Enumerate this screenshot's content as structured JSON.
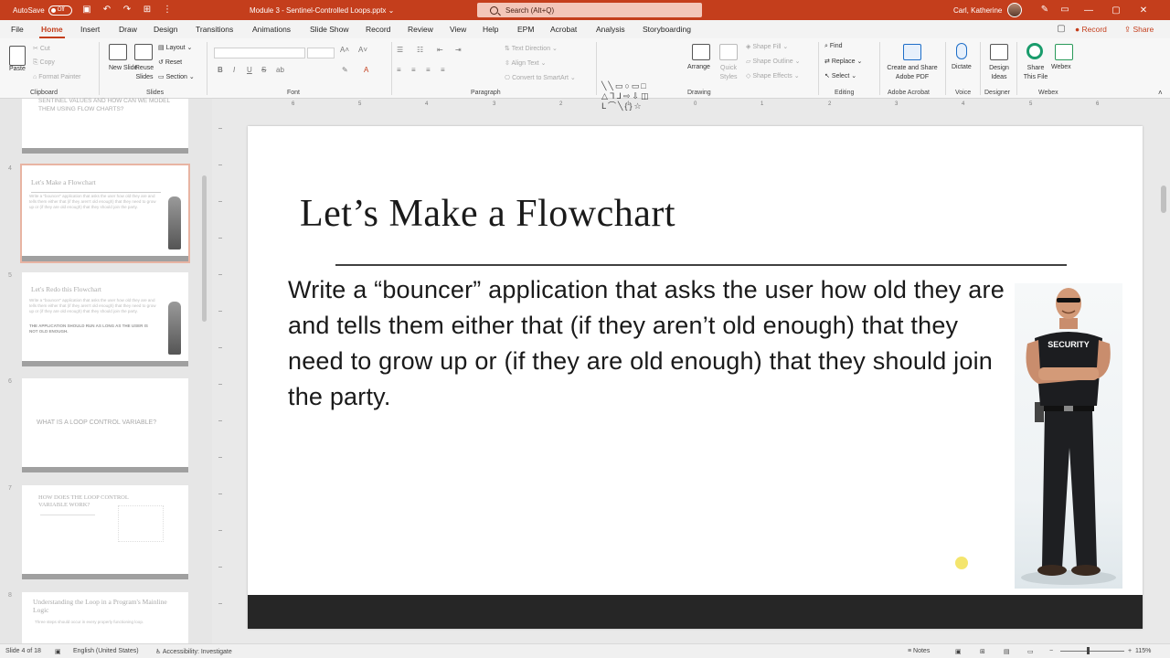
{
  "titlebar": {
    "autosave_label": "AutoSave",
    "autosave_state": "Off",
    "document_title": "Module 3 - Sentinel-Controlled Loops.pptx",
    "search_placeholder": "Search (Alt+Q)",
    "user_name": "Carl, Katherine",
    "minimize": "—",
    "maximize": "▢",
    "close": "✕"
  },
  "menu": {
    "tabs": [
      "File",
      "Home",
      "Insert",
      "Draw",
      "Design",
      "Transitions",
      "Animations",
      "Slide Show",
      "Record",
      "Review",
      "View",
      "Help",
      "EPM",
      "Acrobat",
      "Analysis",
      "Storyboarding"
    ],
    "active": "Home",
    "record": "Record",
    "share": "Share"
  },
  "ribbon": {
    "clipboard": {
      "label": "Clipboard",
      "paste": "Paste",
      "cut": "Cut",
      "copy": "Copy",
      "format_painter": "Format Painter"
    },
    "slides": {
      "label": "Slides",
      "new_slide": "New Slide",
      "reuse_slides": "Reuse Slides",
      "layout": "Layout",
      "reset": "Reset",
      "section": "Section"
    },
    "font": {
      "label": "Font",
      "bold": "B",
      "italic": "I",
      "underline": "U",
      "strike": "S",
      "shadow": "ab"
    },
    "paragraph": {
      "label": "Paragraph",
      "text_direction": "Text Direction",
      "align_text": "Align Text",
      "convert_smartart": "Convert to SmartArt"
    },
    "drawing": {
      "label": "Drawing",
      "arrange": "Arrange",
      "quick_styles": "Quick Styles",
      "shape_fill": "Shape Fill",
      "shape_outline": "Shape Outline",
      "shape_effects": "Shape Effects"
    },
    "editing": {
      "label": "Editing",
      "find": "Find",
      "replace": "Replace",
      "select": "Select"
    },
    "adobe": {
      "label": "Adobe Acrobat",
      "create_share": "Create and Share Adobe PDF"
    },
    "voice": {
      "label": "Voice",
      "dictate": "Dictate"
    },
    "designer": {
      "label": "Designer",
      "design_ideas": "Design Ideas"
    },
    "webex": {
      "label": "Webex",
      "share_file": "Share This File",
      "webex": "Webex"
    }
  },
  "thumbnails": [
    {
      "num": "",
      "title": "SENTINEL VALUES AND HOW CAN WE MODEL THEM USING FLOW CHARTS?",
      "body": ""
    },
    {
      "num": "4",
      "title": "Let's Make a Flowchart",
      "body": "Write a \"bouncer\" application that asks the user how old they are and tells them either that (if they aren't old enough) that they need to grow up or (if they are old enough) that they should join the party."
    },
    {
      "num": "5",
      "title": "Let's Redo this Flowchart",
      "body": "Write a \"bouncer\" application that asks the user how old they are and tells them either that (if they aren't old enough) that they need to grow up or (if they are old enough) that they should join the party.",
      "extra": "THE APPLICATION SHOULD RUN AS LONG AS THE USER IS NOT OLD ENOUGH."
    },
    {
      "num": "6",
      "title": "WHAT IS A LOOP CONTROL VARIABLE?",
      "body": ""
    },
    {
      "num": "7",
      "title": "HOW DOES THE LOOP CONTROL VARIABLE WORK?",
      "body": ""
    },
    {
      "num": "8",
      "title": "Understanding the Loop in a Program's Mainline Logic",
      "body": "Three steps should occur in every properly functioning loop."
    }
  ],
  "ruler": {
    "ticks": [
      "6",
      "5",
      "4",
      "3",
      "2",
      "1",
      "0",
      "1",
      "2",
      "3",
      "4",
      "5",
      "6"
    ]
  },
  "slide": {
    "title": "Let’s Make a Flowchart",
    "body": "Write a “bouncer” application that asks the user how old they are and tells them either that (if they aren’t old enough) that they need to grow up or (if they are old enough) that they should join the party.",
    "shirt_text": "SECURITY"
  },
  "status": {
    "slide_of": "Slide 4 of 18",
    "language": "English (United States)",
    "accessibility": "Accessibility: Investigate",
    "notes": "Notes",
    "zoom": "115%"
  },
  "colors": {
    "accent": "#c43e1c",
    "band": "#262626"
  }
}
